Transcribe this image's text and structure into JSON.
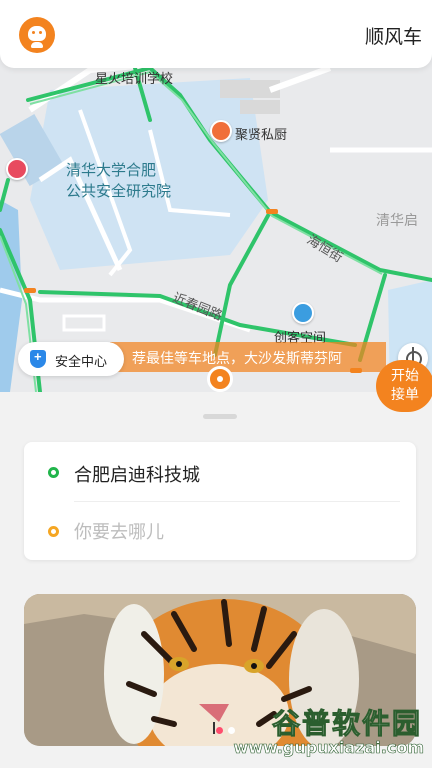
{
  "header": {
    "avatar_icon": "user-avatar-icon",
    "title": "顺风车"
  },
  "map": {
    "labels": {
      "school": "星火培训学校",
      "restaurant": "聚贤私厨",
      "campus_line1": "清华大学合肥",
      "campus_line2": "公共安全研究院",
      "area_right": "清华启",
      "street_haiheng": "海恒街",
      "street_jinchun": "近春园路",
      "space": "创客空间"
    },
    "safety_center": "安全中心",
    "marquee_text": "荐最佳等车地点，大沙发斯蒂芬阿",
    "start_button_line1": "开始",
    "start_button_line2": "接单"
  },
  "route": {
    "from": "合肥启迪科技城",
    "to_placeholder": "你要去哪儿"
  },
  "banner": {
    "active_page": 1,
    "page_count": 2
  },
  "watermark": {
    "cn": "谷普软件园",
    "url": "www.gupuxiazai.com"
  },
  "colors": {
    "accent": "#f3831f",
    "origin_dot": "#21b54b",
    "destination_dot": "#f5a623",
    "road_green": "#2fc46a",
    "water": "#cde4f5"
  }
}
